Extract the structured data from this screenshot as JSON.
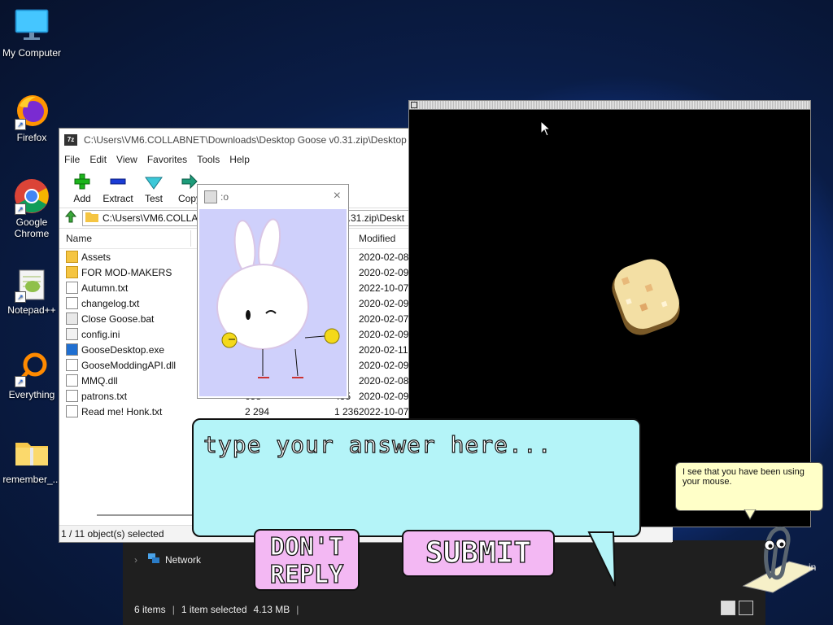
{
  "desktop": {
    "icons": [
      {
        "label": "My Computer",
        "icon": "computer-monitor-icon"
      },
      {
        "label": "Firefox",
        "icon": "firefox-icon"
      },
      {
        "label": "Google Chrome",
        "icon": "chrome-icon"
      },
      {
        "label": "Notepad++",
        "icon": "notepadpp-icon"
      },
      {
        "label": "Everything",
        "icon": "everything-search-icon"
      },
      {
        "label": "remember_...",
        "icon": "folder-zip-icon"
      }
    ]
  },
  "zip": {
    "title": "C:\\Users\\VM6.COLLABNET\\Downloads\\Desktop Goose v0.31.zip\\Desktop Go",
    "app_icon_text": "7z",
    "menu": [
      "File",
      "Edit",
      "View",
      "Favorites",
      "Tools",
      "Help"
    ],
    "toolbar": [
      "Add",
      "Extract",
      "Test",
      "Copy"
    ],
    "path": "C:\\Users\\VM6.COLLABNET\\Downloads\\Desktop Goose v0.31.zip\\Deskt",
    "path_visible_left": "C:\\Users\\VM6.COLLA",
    "path_visible_right": "0.31.zip\\Deskt",
    "columns": {
      "name": "Name",
      "modified": "Modified"
    },
    "files": [
      {
        "name": "Assets",
        "type": "folder",
        "size": "",
        "packed": "",
        "modified": "2020-02-08"
      },
      {
        "name": "FOR MOD-MAKERS",
        "type": "folder",
        "size": "",
        "packed": "",
        "modified": "2020-02-09"
      },
      {
        "name": "Autumn.txt",
        "type": "txt",
        "size": "",
        "packed": "",
        "modified": "2022-10-07"
      },
      {
        "name": "changelog.txt",
        "type": "txt",
        "size": "",
        "packed": "",
        "modified": "2020-02-09"
      },
      {
        "name": "Close Goose.bat",
        "type": "bat",
        "size": "",
        "packed": "",
        "modified": "2020-02-07"
      },
      {
        "name": "config.ini",
        "type": "ini",
        "size": "",
        "packed": "",
        "modified": "2020-02-09"
      },
      {
        "name": "GooseDesktop.exe",
        "type": "exe",
        "size": "",
        "packed": "",
        "modified": "2020-02-11"
      },
      {
        "name": "GooseModdingAPI.dll",
        "type": "dll",
        "size": "",
        "packed": "",
        "modified": "2020-02-09"
      },
      {
        "name": "MMQ.dll",
        "type": "dll",
        "size": "",
        "packed": "",
        "modified": "2020-02-08"
      },
      {
        "name": "patrons.txt",
        "type": "txt",
        "size": "658",
        "packed": "435",
        "modified": "2020-02-09"
      },
      {
        "name": "Read me! Honk.txt",
        "type": "txt",
        "size": "2 294",
        "packed": "1 236",
        "modified": "2022-10-07"
      }
    ],
    "status": "1 / 11 object(s) selected"
  },
  "explorer": {
    "network_label": "Network",
    "items_count": "6 items",
    "selected": "1 item selected",
    "size": "4.13 MB",
    "separator": "|"
  },
  "bunny_window": {
    "title": ":o"
  },
  "goose_prompt": {
    "input_placeholder": "type your answer here...",
    "dont_reply_label": "DON'T REPLY",
    "submit_label": "SUBMIT"
  },
  "clippy": {
    "message": "I see that you have been using your mouse.",
    "partial_text": "in"
  },
  "colors": {
    "bubble": "#b4f4f8",
    "pink_button": "#f3b8f3",
    "bunny_bg": "#cfd0fb",
    "tip_bg": "#ffffc8"
  }
}
